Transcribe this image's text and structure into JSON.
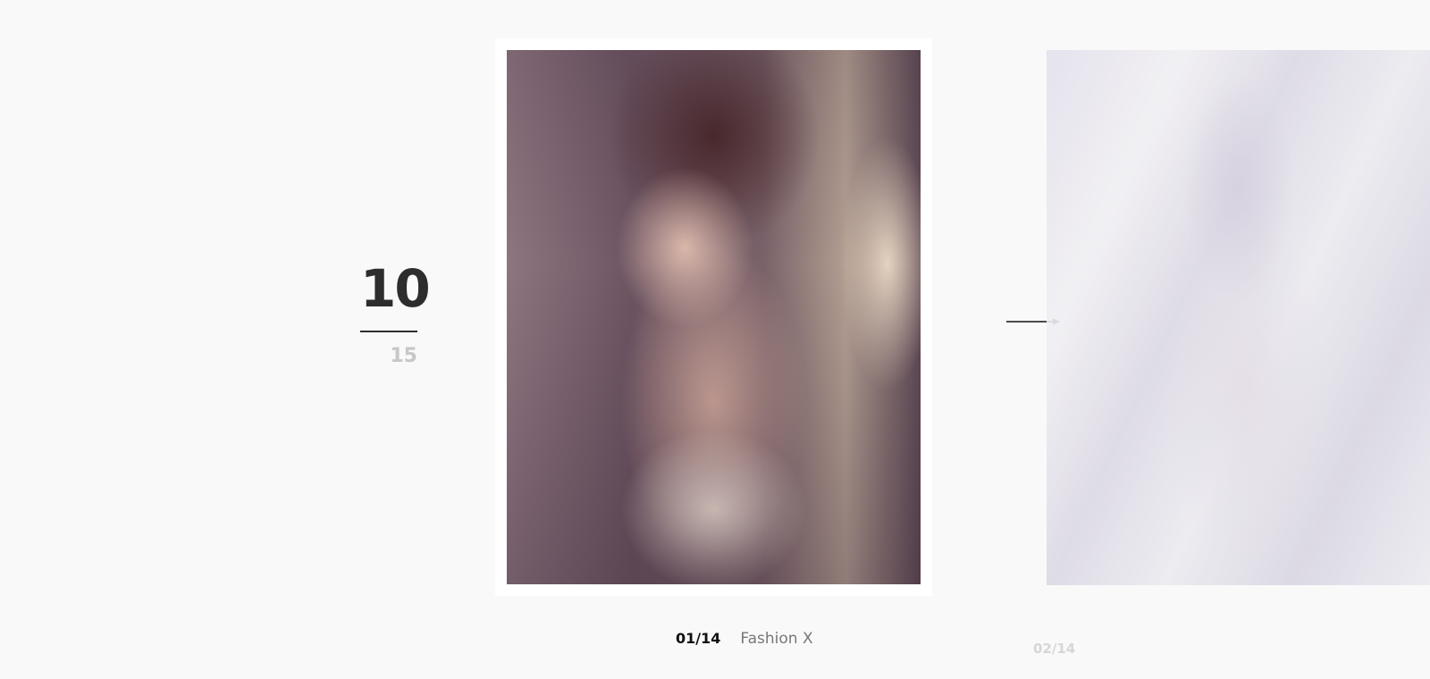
{
  "counter": {
    "current": "10",
    "total": "15"
  },
  "slides": [
    {
      "number": "01/14",
      "title": "Fashion X",
      "image": "photo-portrait-woman-satin-bra"
    },
    {
      "number": "02/14",
      "image": "photo-woman-lace-cardigan-faded"
    }
  ],
  "navigation": {
    "next_icon": "arrow-right-icon"
  },
  "colors": {
    "background": "#f9f9f9",
    "counter_current": "#2d2d2d",
    "counter_total": "#c7c7c7",
    "caption_number": "#111111",
    "caption_title": "#777777",
    "next_number": "#d6d6d6"
  }
}
